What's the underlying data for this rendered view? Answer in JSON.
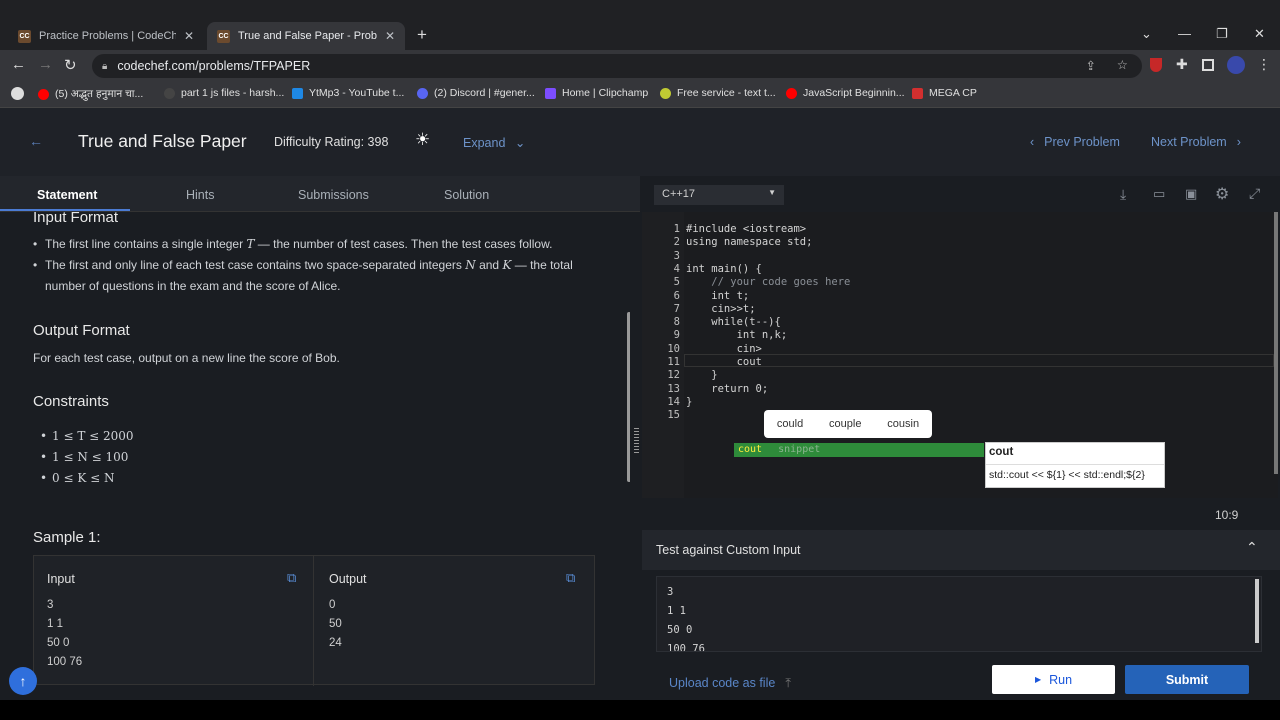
{
  "browser": {
    "tabs": [
      {
        "icon_text": "CC",
        "title": "Practice Problems | CodeChef"
      },
      {
        "icon_text": "CC",
        "title": "True and False Paper - Problems | C"
      }
    ],
    "url": "codechef.com/problems/TFPAPER",
    "bookmarks": [
      {
        "label": "(5) अद्भुत हनुमान चा...",
        "color": "#ff0000"
      },
      {
        "label": "part 1 js files - harsh...",
        "color": "#333333"
      },
      {
        "label": "YtMp3 - YouTube t...",
        "color": "#1e88e5"
      },
      {
        "label": "(2) Discord | #gener...",
        "color": "#5865f2"
      },
      {
        "label": "Home | Clipchamp",
        "color": "#7c4dff"
      },
      {
        "label": "Free service - text t...",
        "color": "#c0ca33"
      },
      {
        "label": "JavaScript Beginnin...",
        "color": "#ff0000"
      },
      {
        "label": "MEGA CP",
        "color": "#d32f2f"
      }
    ]
  },
  "header": {
    "title": "True and False Paper",
    "difficulty": "Difficulty Rating: 398",
    "expand": "Expand",
    "prev": "Prev Problem",
    "next": "Next Problem"
  },
  "statement_tabs": [
    "Statement",
    "Hints",
    "Submissions",
    "Solution"
  ],
  "statement": {
    "input_format_heading": "Input Format",
    "input_b1_pre": "The first line contains a single integer ",
    "input_b1_var": "T",
    "input_b1_post": " — the number of test cases. Then the test cases follow.",
    "input_b2_pre": "The first and only line of each test case contains two space-separated integers ",
    "input_b2_var1": "N",
    "input_b2_mid": " and ",
    "input_b2_var2": "K",
    "input_b2_post": " — the total number of questions in the exam and the score of Alice.",
    "output_format_heading": "Output Format",
    "output_text": "For each test case, output on a new line the score of Bob.",
    "constraints_heading": "Constraints",
    "constraints": [
      "1 ≤ T ≤ 2000",
      "1 ≤ N ≤ 100",
      "0 ≤ K ≤ N"
    ],
    "sample_heading": "Sample 1:",
    "sample_input_label": "Input",
    "sample_output_label": "Output",
    "sample_input": [
      "3",
      "1 1",
      "50 0",
      "100 76"
    ],
    "sample_output": [
      "0",
      "50",
      "24"
    ]
  },
  "editor": {
    "language": "C++17",
    "lines": [
      "#include <iostream>",
      "using namespace std;",
      "",
      "int main() {",
      "    // your code goes here",
      "    int t;",
      "    cin>>t;",
      "    while(t--){",
      "        int n,k;",
      "        cin>",
      "        cout",
      "    }",
      "    return 0;",
      "}",
      ""
    ],
    "autocomplete_words": [
      "could",
      "couple",
      "cousin"
    ],
    "suggestion": {
      "label": "cout",
      "kind": "snippet"
    },
    "suggestion_detail_title": "cout",
    "suggestion_detail_body": "std::cout << ${1} << std::endl;${2}",
    "cursor_pos": "10:9"
  },
  "custom_input": {
    "heading": "Test against Custom Input",
    "lines": [
      "3",
      "1 1",
      "50 0",
      "100 76"
    ]
  },
  "actions": {
    "upload": "Upload code as file",
    "run": "Run",
    "submit": "Submit"
  }
}
